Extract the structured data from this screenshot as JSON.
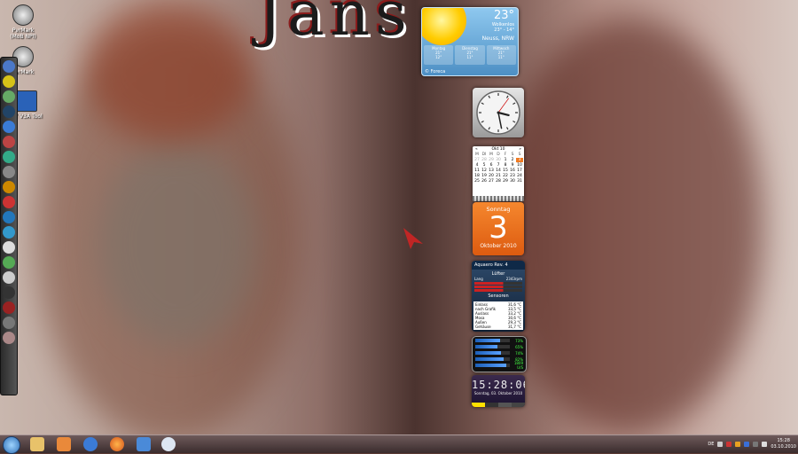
{
  "wallpaper": {
    "title": "Jans"
  },
  "desktop_icons": [
    {
      "label": "PvrMark (MoB NPI)"
    },
    {
      "label": "PvrMark"
    },
    {
      "label": "BT V3A Tool"
    }
  ],
  "weather": {
    "temperature": "23°",
    "condition": "Wolkenlos",
    "range": "23° - 14°",
    "location": "Neuss, NRW",
    "days": [
      {
        "name": "Montag",
        "hi": "21°",
        "lo": "12°"
      },
      {
        "name": "Dienstag",
        "hi": "21°",
        "lo": "11°"
      },
      {
        "name": "Mittwoch",
        "hi": "21°",
        "lo": "11°"
      }
    ],
    "provider": "© Foreca"
  },
  "clock_gadget": {
    "hours": 15,
    "minutes": 28,
    "seconds": 6
  },
  "calendar": {
    "month": "Okt 10",
    "prev": "«",
    "next": "»",
    "weekdays": [
      "M",
      "DI",
      "M",
      "D",
      "F",
      "S",
      "S"
    ],
    "days": [
      "27",
      "28",
      "29",
      "30",
      "1",
      "2",
      "3",
      "4",
      "5",
      "6",
      "7",
      "8",
      "9",
      "10",
      "11",
      "12",
      "13",
      "14",
      "15",
      "16",
      "17",
      "18",
      "19",
      "20",
      "21",
      "22",
      "23",
      "24",
      "25",
      "26",
      "27",
      "28",
      "29",
      "30",
      "31"
    ],
    "selected": "3"
  },
  "date_gadget": {
    "weekday": "Sonntag",
    "day": "3",
    "month_year": "Oktober 2010"
  },
  "aquaero": {
    "title": "Aquaero Rev. 4",
    "fans_header": "Lüfter",
    "fan_label": "Lang",
    "fan_value": "2343rpm",
    "sensors_header": "Sensoren",
    "sensors": [
      {
        "name": "Einlass",
        "value": "31,6 °C"
      },
      {
        "name": "nach Grafik",
        "value": "33,5 °C"
      },
      {
        "name": "Auslass",
        "value": "33,2 °C"
      },
      {
        "name": "Mosa",
        "value": "30,6 °C"
      },
      {
        "name": "Außen",
        "value": "29,3 °C"
      },
      {
        "name": "Gehäuse",
        "value": "31,7 °C"
      }
    ]
  },
  "meter_gadget": {
    "bars": [
      {
        "label": "73%",
        "fraction": 0.73
      },
      {
        "label": "65%",
        "fraction": 0.65
      },
      {
        "label": "74%",
        "fraction": 0.74
      },
      {
        "label": "82%",
        "fraction": 0.82
      },
      {
        "label": "1809 U/S",
        "fraction": 0.9
      }
    ]
  },
  "digital_clock": {
    "time": "15:28:06",
    "date": "Sonntag, 03. Oktober 2010"
  },
  "taskbar": {
    "language": "DE",
    "time": "15:28",
    "date": "03.10.2010"
  },
  "colors": {
    "accent_orange": "#f07a22",
    "weather_blue": "#4d8fc4",
    "taskbar": "#4a3a3b"
  }
}
